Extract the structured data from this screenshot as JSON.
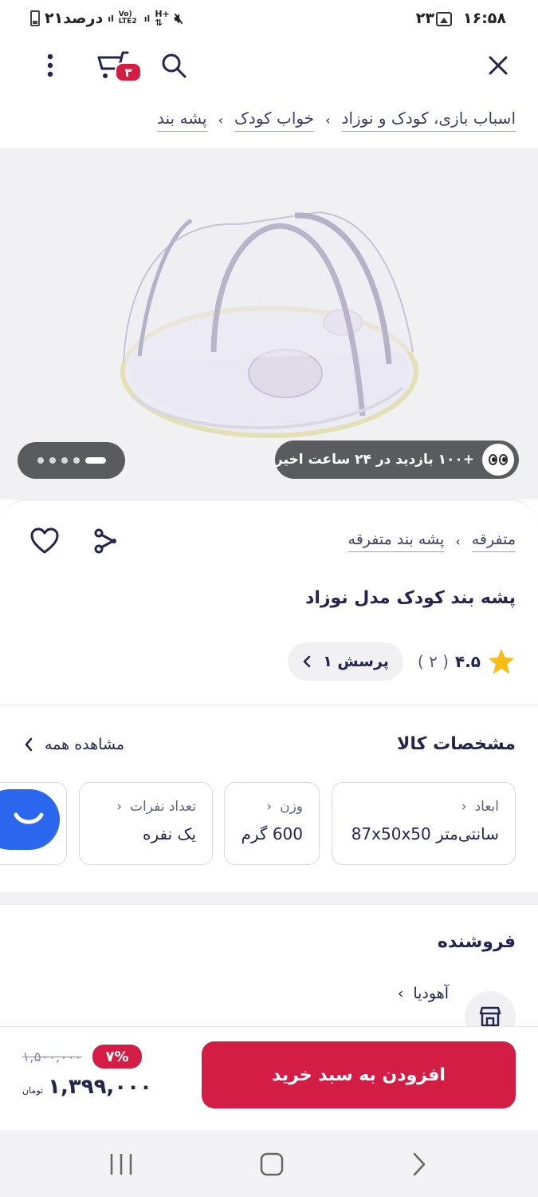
{
  "status_bar": {
    "time": "۱۶:۵۸",
    "notification_count": "۲۳",
    "battery_text": "۲۱درصد",
    "network_label": "Vo) LTE2"
  },
  "header": {
    "cart_count": "۳"
  },
  "breadcrumb": [
    "اسباب بازی، کودک و نوزاد",
    "خواب کودک",
    "پشه بند"
  ],
  "gallery": {
    "views_text": "+۱۰۰ بازدید در ۲۴ ساعت اخیر",
    "dots": 5,
    "active_dot": 0
  },
  "product": {
    "category": [
      "متفرقه",
      "پشه بند متفرقه"
    ],
    "title": "پشه بند کودک مدل نوزاد",
    "rating": "۴.۵",
    "rating_count": "( ۲ )",
    "questions": "۱ پرسش"
  },
  "specs": {
    "title": "مشخصات کالا",
    "view_all": "مشاهده همه",
    "items": [
      {
        "label": "ابعاد",
        "value": "سانتی‌متر 87x50x50"
      },
      {
        "label": "وزن",
        "value": "600 گرم"
      },
      {
        "label": "تعداد نفرات",
        "value": "یک نفره"
      }
    ]
  },
  "seller": {
    "title": "فروشنده",
    "name": "آهودیا"
  },
  "buy_bar": {
    "add_to_cart": "افزودن به سبد خرید",
    "discount": "۷%",
    "old_price": "۱,۵۰۰,۰۰۰",
    "price": "۱,۳۹۹,۰۰۰",
    "currency": "تومان"
  },
  "colors": {
    "brand_red": "#d41d45",
    "text_dark": "#23254e",
    "blue_accent": "#2b67ee",
    "star": "#f9bc15"
  }
}
